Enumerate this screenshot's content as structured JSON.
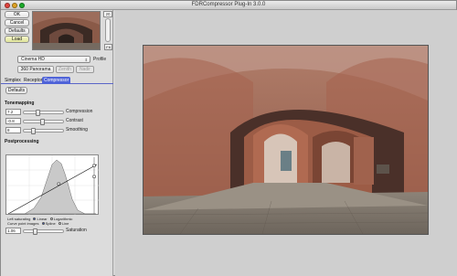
{
  "window": {
    "title": "FDRCompressor Plug-In 3.0.0"
  },
  "toolbar": {
    "ok_label": "OK",
    "cancel_label": "Cancel",
    "defaults_label": "Defaults",
    "load_label": "Load"
  },
  "zoom": {
    "value": "20",
    "fit_label": "Fit"
  },
  "profile": {
    "selected": "Cinema HD",
    "label": "Profile",
    "buttons": [
      "360 Panorama",
      "Zenith",
      "Nadir"
    ]
  },
  "tabs": [
    "Simplex",
    "Receptor",
    "Compressor"
  ],
  "compressor": {
    "defaults_label": "Defaults",
    "tonemapping_label": "Tonemapping",
    "rows": [
      {
        "value": "7.2",
        "label": "Compression",
        "knob_fraction": 0.34
      },
      {
        "value": "-0.8",
        "label": "Contrast",
        "knob_fraction": 0.48
      },
      {
        "value": "8",
        "label": "Smoothing",
        "knob_fraction": 0.2
      }
    ],
    "postprocessing_label": "Postprocessing",
    "curve_options": {
      "left_label": "Left saturating",
      "linear_label": "Linear",
      "log_label": "Logarithmic",
      "curve_point_label": "Curve point images",
      "spline_label": "Spline",
      "line_label": "Line"
    },
    "saturation": {
      "value": "1.06",
      "label": "Saturation",
      "knob_fraction": 0.25
    }
  },
  "colors": {
    "tab_active": "#4f63d8",
    "load_button": "#e6e9a8"
  }
}
